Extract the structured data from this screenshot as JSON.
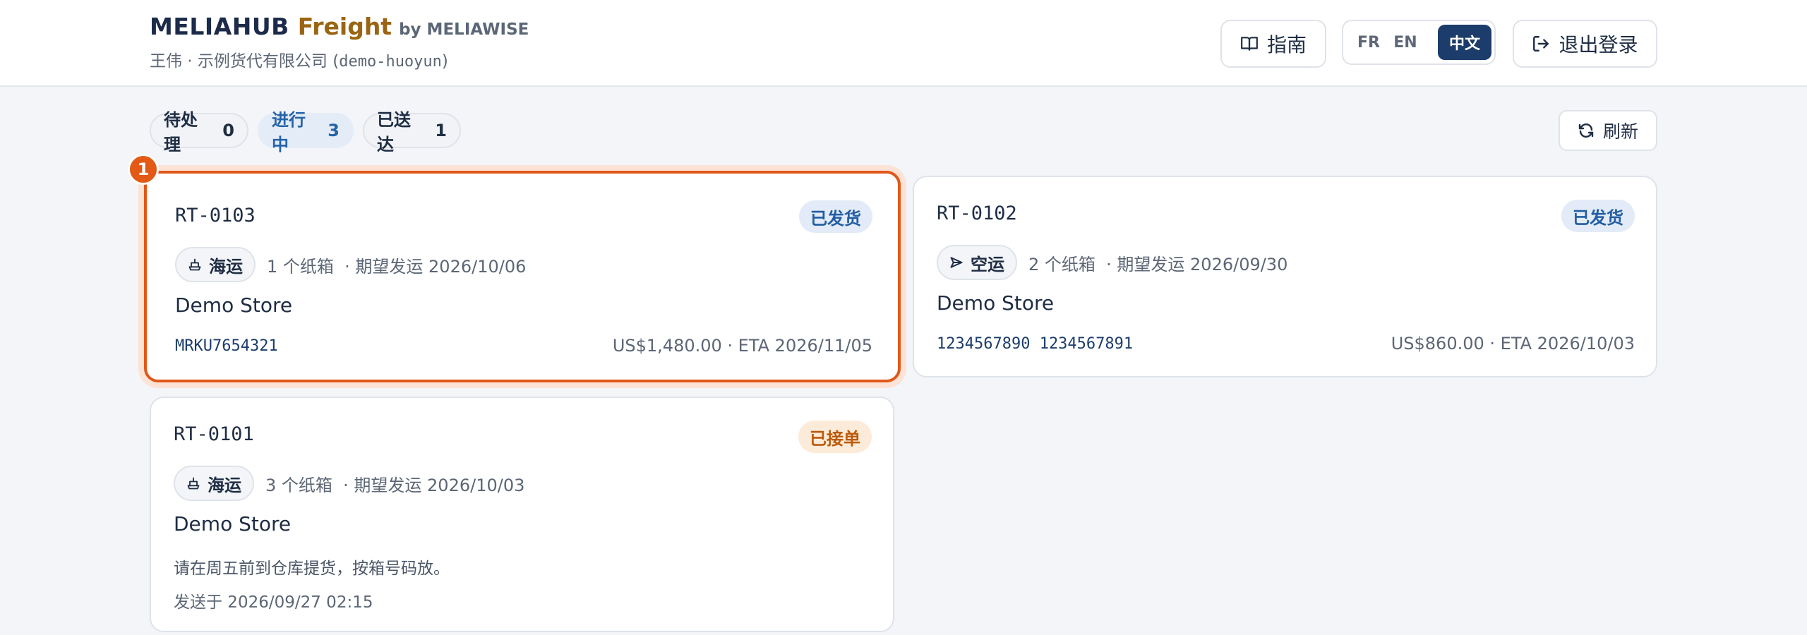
{
  "header": {
    "brand_name": "MELIAHUB",
    "brand_product": "Freight",
    "brand_by": "by MELIAWISE",
    "user_line": "王伟 · 示例货代有限公司 (",
    "org_code": "demo-huoyun",
    "user_line_end": ")",
    "guide_label": "指南",
    "languages": [
      "FR",
      "EN",
      "中文"
    ],
    "active_language": "中文",
    "logout_label": "退出登录"
  },
  "filters": [
    {
      "label": "待处理",
      "count": "0"
    },
    {
      "label": "进行中",
      "count": "3"
    },
    {
      "label": "已送达",
      "count": "1"
    }
  ],
  "refresh_label": "刷新",
  "selection_marker": "1",
  "orders": [
    {
      "id": "RT-0103",
      "status": "已发货",
      "mode": "海运",
      "meta": "1 个纸箱  · 期望发运 2026/10/06",
      "store": "Demo Store",
      "tracking": "MRKU7654321",
      "price_eta": "US$1,480.00 · ETA 2026/11/05"
    },
    {
      "id": "RT-0102",
      "status": "已发货",
      "mode": "空运",
      "meta": "2 个纸箱  · 期望发运 2026/09/30",
      "store": "Demo Store",
      "tracking": "1234567890 1234567891",
      "price_eta": "US$860.00 · ETA 2026/10/03"
    },
    {
      "id": "RT-0101",
      "status": "已接单",
      "mode": "海运",
      "meta": "3 个纸箱  · 期望发运 2026/10/03",
      "store": "Demo Store",
      "note": "请在周五前到仓库提货，按箱号码放。",
      "sent_at": "发送于 2026/09/27 02:15"
    }
  ],
  "colors": {
    "accent_dark": "#1c3d6b",
    "brand_gold": "#9a6512",
    "selected_border": "#e0581a",
    "status_shipped": "#225da3",
    "status_accepted": "#bb5a0b"
  },
  "icons": {
    "guide": "book-open-icon",
    "logout": "logout-icon",
    "refresh": "refresh-icon",
    "sea": "ship-icon",
    "air": "plane-icon"
  }
}
